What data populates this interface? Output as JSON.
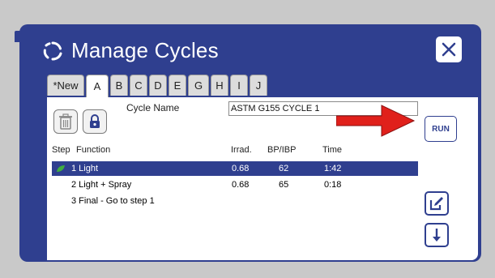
{
  "dialog": {
    "title": "Manage Cycles"
  },
  "tabs": [
    "*New",
    "A",
    "B",
    "C",
    "D",
    "E",
    "G",
    "H",
    "I",
    "J"
  ],
  "active_tab": "A",
  "cycle": {
    "label": "Cycle Name",
    "value": "ASTM G155 CYCLE 1"
  },
  "table": {
    "headers": {
      "step": "Step",
      "function": "Function",
      "irrad": "Irrad.",
      "bp": "BP/IBP",
      "time": "Time"
    },
    "rows": [
      {
        "step_function": "1 Light",
        "irrad": "0.68",
        "bp": "62",
        "time": "1:42",
        "selected": true
      },
      {
        "step_function": "2 Light + Spray",
        "irrad": "0.68",
        "bp": "65",
        "time": "0:18",
        "selected": false
      },
      {
        "step_function": "3 Final - Go to step 1",
        "irrad": "",
        "bp": "",
        "time": "",
        "selected": false
      }
    ]
  },
  "buttons": {
    "run": "RUN"
  },
  "icons": [
    "cycle-icon",
    "close-icon",
    "trash-icon",
    "lock-icon",
    "edit-icon",
    "arrow-down-icon",
    "right-arrow-icon",
    "status-leaf-icon"
  ],
  "colors": {
    "panel": "#2f3f8f",
    "selected_row": "#2f3f8f",
    "arrow": "#e0201b",
    "background": "#c9c9c9"
  }
}
